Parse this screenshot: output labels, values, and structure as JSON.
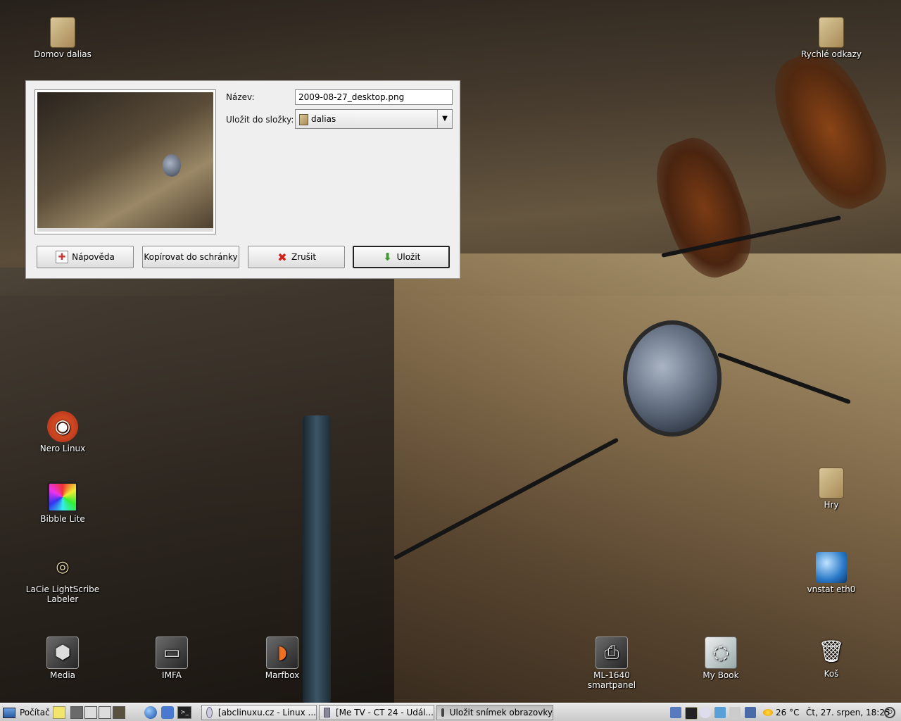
{
  "desktop": {
    "icons": [
      {
        "label": "Domov dalias"
      },
      {
        "label": "Rychlé odkazy"
      },
      {
        "label": "Nero Linux"
      },
      {
        "label": "Bibble Lite"
      },
      {
        "label": "LaCie LightScribe Labeler"
      },
      {
        "label": "Hry"
      },
      {
        "label": "vnstat eth0"
      },
      {
        "label": "Media"
      },
      {
        "label": "IMFA"
      },
      {
        "label": "Marfbox"
      },
      {
        "label": "ML-1640 smartpanel"
      },
      {
        "label": "My Book"
      },
      {
        "label": "Koš"
      }
    ]
  },
  "dialog": {
    "name_label": "Název:",
    "name_value": "2009-08-27_desktop.png",
    "folder_label": "Uložit do složky:",
    "folder_value": "dalias",
    "buttons": {
      "help": "Nápověda",
      "copy": "Kopírovat do schránky",
      "cancel": "Zrušit",
      "save": "Uložit"
    }
  },
  "taskbar": {
    "start_label": "Počítač",
    "tasks": [
      {
        "label": "[abclinuxu.cz - Linux ..."
      },
      {
        "label": "[Me TV - CT 24 - Udál..."
      },
      {
        "label": "Uložit snímek obrazovky"
      }
    ],
    "temperature": "26 °C",
    "clock": "Čt, 27. srpen, 18:25"
  },
  "colors": {
    "dialog_bg": "#efefef",
    "taskbar_bg": "#d6d6d6",
    "cancel_red": "#d0201a",
    "save_green": "#3a9a2a"
  }
}
